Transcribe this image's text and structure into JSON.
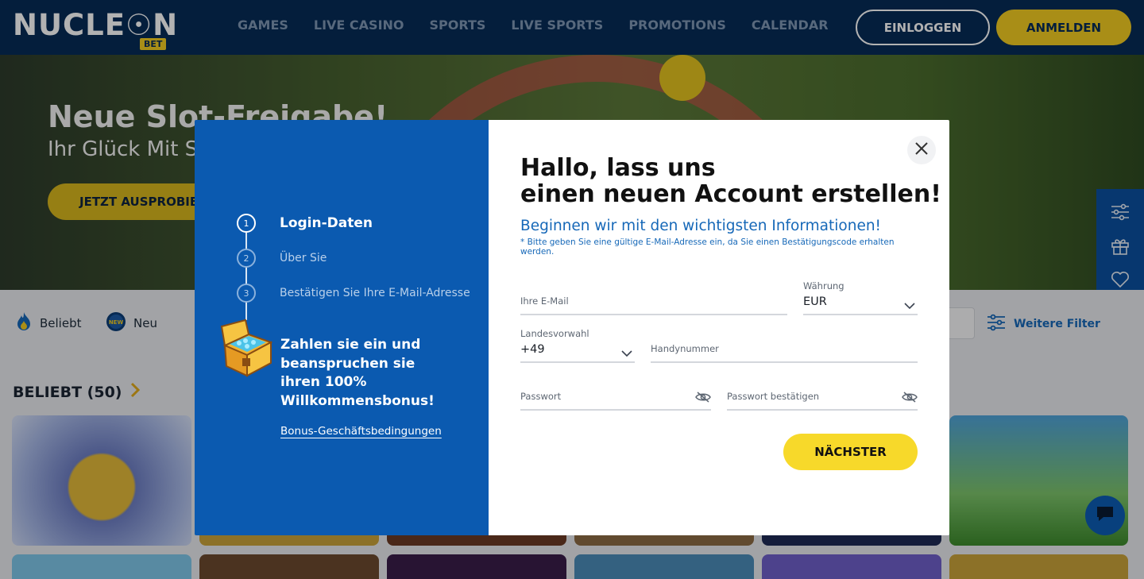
{
  "header": {
    "logo_text": "NUCLE☉N",
    "logo_sub": "BET",
    "nav": [
      "GAMES",
      "LIVE CASINO",
      "SPORTS",
      "LIVE SPORTS",
      "PROMOTIONS",
      "CALENDAR"
    ],
    "login_label": "EINLOGGEN",
    "register_label": "ANMELDEN"
  },
  "hero": {
    "title": "Neue Slot-Freigabe!",
    "subtitle": "Ihr Glück Mit Sh",
    "cta": "JETZT AUSPROBIE"
  },
  "filters": {
    "chips": [
      {
        "icon": "flame-icon",
        "label": "Beliebt"
      },
      {
        "icon": "new-badge-icon",
        "label": "Neu"
      }
    ],
    "more_label": "Weitere Filter"
  },
  "section": {
    "title": "BELIEBT (50)"
  },
  "modal": {
    "steps": [
      {
        "number": "1",
        "label": "Login-Daten",
        "active": true
      },
      {
        "number": "2",
        "label": "Über Sie",
        "active": false
      },
      {
        "number": "3",
        "label": "Bestätigen Sie Ihre E-Mail-Adresse",
        "active": false
      }
    ],
    "promo_line1": "Zahlen sie ein und",
    "promo_line2": "beanspruchen sie",
    "promo_line3": "ihren 100%",
    "promo_line4": "Willkommensbonus!",
    "bonus_link": "Bonus-Geschäftsbedingungen",
    "heading_line1": "Hallo, lass uns",
    "heading_line2": "einen neuen Account erstellen!",
    "subheading": "Beginnen wir mit den wichtigsten Informationen!",
    "hint": "* Bitte geben Sie eine gültige E-Mail-Adresse ein, da Sie einen Bestätigungscode erhalten werden.",
    "fields": {
      "email_label": "Ihre E-Mail",
      "currency_label": "Währung",
      "currency_value": "EUR",
      "country_code_label": "Landesvorwahl",
      "country_code_value": "+49",
      "phone_label": "Handynummer",
      "password_label": "Passwort",
      "password_confirm_label": "Passwort bestätigen"
    },
    "next_label": "NÄCHSTER"
  },
  "colors": {
    "navy": "#072b57",
    "brand_blue": "#0b5ab0",
    "link_blue": "#1668b8",
    "yellow": "#f7d92a"
  }
}
